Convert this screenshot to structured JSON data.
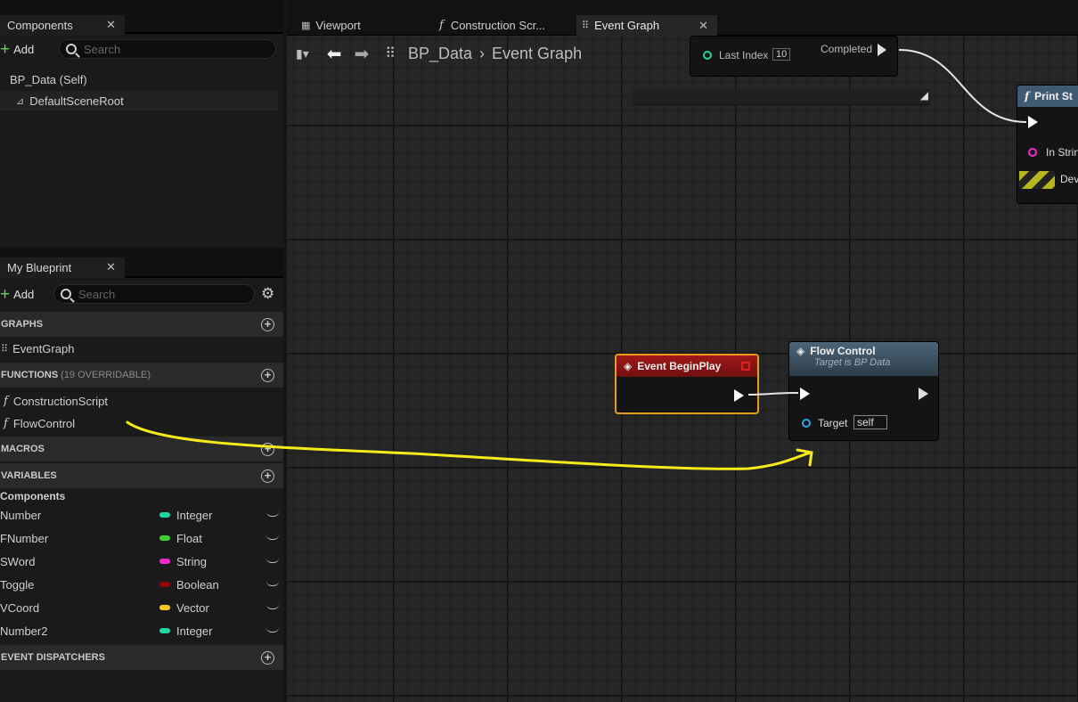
{
  "components_panel": {
    "tab_title": "Components",
    "add_label": "Add",
    "search_placeholder": "Search",
    "items": [
      {
        "label": "BP_Data (Self)"
      },
      {
        "label": "DefaultSceneRoot"
      }
    ]
  },
  "blueprint_panel": {
    "tab_title": "My Blueprint",
    "add_label": "Add",
    "search_placeholder": "Search",
    "sections": {
      "graphs": "GRAPHS",
      "functions": "FUNCTIONS",
      "functions_sub": "(19 OVERRIDABLE)",
      "macros": "MACROS",
      "variables": "VARIABLES",
      "event_dispatchers": "EVENT DISPATCHERS"
    },
    "graphs": [
      {
        "label": "EventGraph"
      }
    ],
    "functions": [
      {
        "label": "ConstructionScript"
      },
      {
        "label": "FlowControl"
      }
    ],
    "variables_category": "Components",
    "variables": [
      {
        "name": "Number",
        "type": "Integer",
        "color": "#1fd6a0"
      },
      {
        "name": "FNumber",
        "type": "Float",
        "color": "#3fd02e"
      },
      {
        "name": "SWord",
        "type": "String",
        "color": "#f22ad0"
      },
      {
        "name": "Toggle",
        "type": "Boolean",
        "color": "#950000"
      },
      {
        "name": "VCoord",
        "type": "Vector",
        "color": "#f5c620"
      },
      {
        "name": "Number2",
        "type": "Integer",
        "color": "#1fd6a0"
      }
    ]
  },
  "editor_tabs": [
    {
      "label": "Viewport"
    },
    {
      "label": "Construction Scr..."
    },
    {
      "label": "Event Graph"
    }
  ],
  "breadcrumb": {
    "root": "BP_Data",
    "current": "Event Graph"
  },
  "graph": {
    "top_node": {
      "last_index_label": "Last Index",
      "last_index_value": "10",
      "completed_label": "Completed"
    },
    "print_node": {
      "title": "Print St",
      "in_string_label": "In Strin",
      "dev_label": "Dev"
    },
    "begin_play": {
      "title": "Event BeginPlay"
    },
    "flow_control": {
      "title": "Flow Control",
      "subtitle": "Target is BP Data",
      "target_label": "Target",
      "target_value": "self"
    }
  },
  "colors": {
    "accent_annotation": "#f7ea1a",
    "begin_play_header": "#8a1414",
    "flow_control_header": "#3d5160"
  }
}
